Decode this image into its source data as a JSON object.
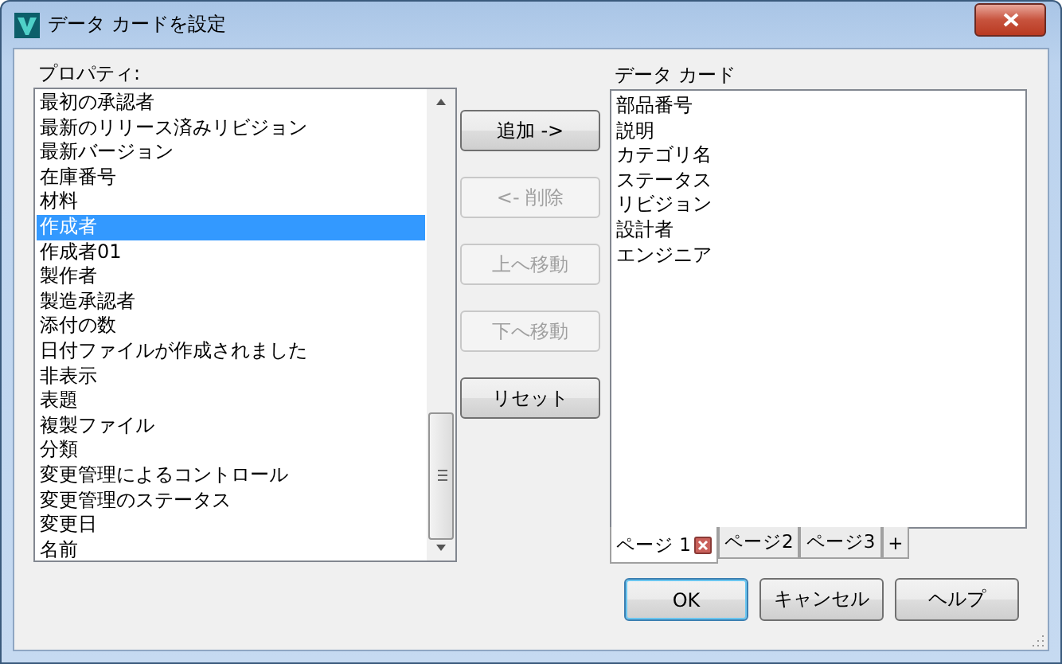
{
  "window": {
    "title": "データ カードを設定"
  },
  "properties": {
    "label": "プロパティ:",
    "items": [
      {
        "label": "最初の承認者",
        "selected": false
      },
      {
        "label": "最新のリリース済みリビジョン",
        "selected": false
      },
      {
        "label": "最新バージョン",
        "selected": false
      },
      {
        "label": "在庫番号",
        "selected": false
      },
      {
        "label": "材料",
        "selected": false
      },
      {
        "label": "作成者",
        "selected": true
      },
      {
        "label": "作成者01",
        "selected": false
      },
      {
        "label": "製作者",
        "selected": false
      },
      {
        "label": "製造承認者",
        "selected": false
      },
      {
        "label": "添付の数",
        "selected": false
      },
      {
        "label": "日付ファイルが作成されました",
        "selected": false
      },
      {
        "label": "非表示",
        "selected": false
      },
      {
        "label": "表題",
        "selected": false
      },
      {
        "label": "複製ファイル",
        "selected": false
      },
      {
        "label": "分類",
        "selected": false
      },
      {
        "label": "変更管理によるコントロール",
        "selected": false
      },
      {
        "label": "変更管理のステータス",
        "selected": false
      },
      {
        "label": "変更日",
        "selected": false
      },
      {
        "label": "名前",
        "selected": false
      }
    ]
  },
  "actions": [
    {
      "label": "追加 ->",
      "disabled": false
    },
    {
      "label": "<- 削除",
      "disabled": true
    },
    {
      "label": "上へ移動",
      "disabled": true
    },
    {
      "label": "下へ移動",
      "disabled": true
    },
    {
      "label": "リセット",
      "disabled": false
    }
  ],
  "data_card": {
    "label": "データ カード",
    "items": [
      "部品番号",
      "説明",
      "カテゴリ名",
      "ステータス",
      "リビジョン",
      "設計者",
      "エンジニア"
    ],
    "pages": [
      {
        "label": "ページ 1",
        "selected": true
      },
      {
        "label": "ページ2",
        "selected": false
      },
      {
        "label": "ページ3",
        "selected": false
      }
    ],
    "add_page": "+"
  },
  "buttons": [
    {
      "label": "OK",
      "default": true
    },
    {
      "label": "キャンセル",
      "default": false
    },
    {
      "label": "ヘルプ",
      "default": false
    }
  ]
}
